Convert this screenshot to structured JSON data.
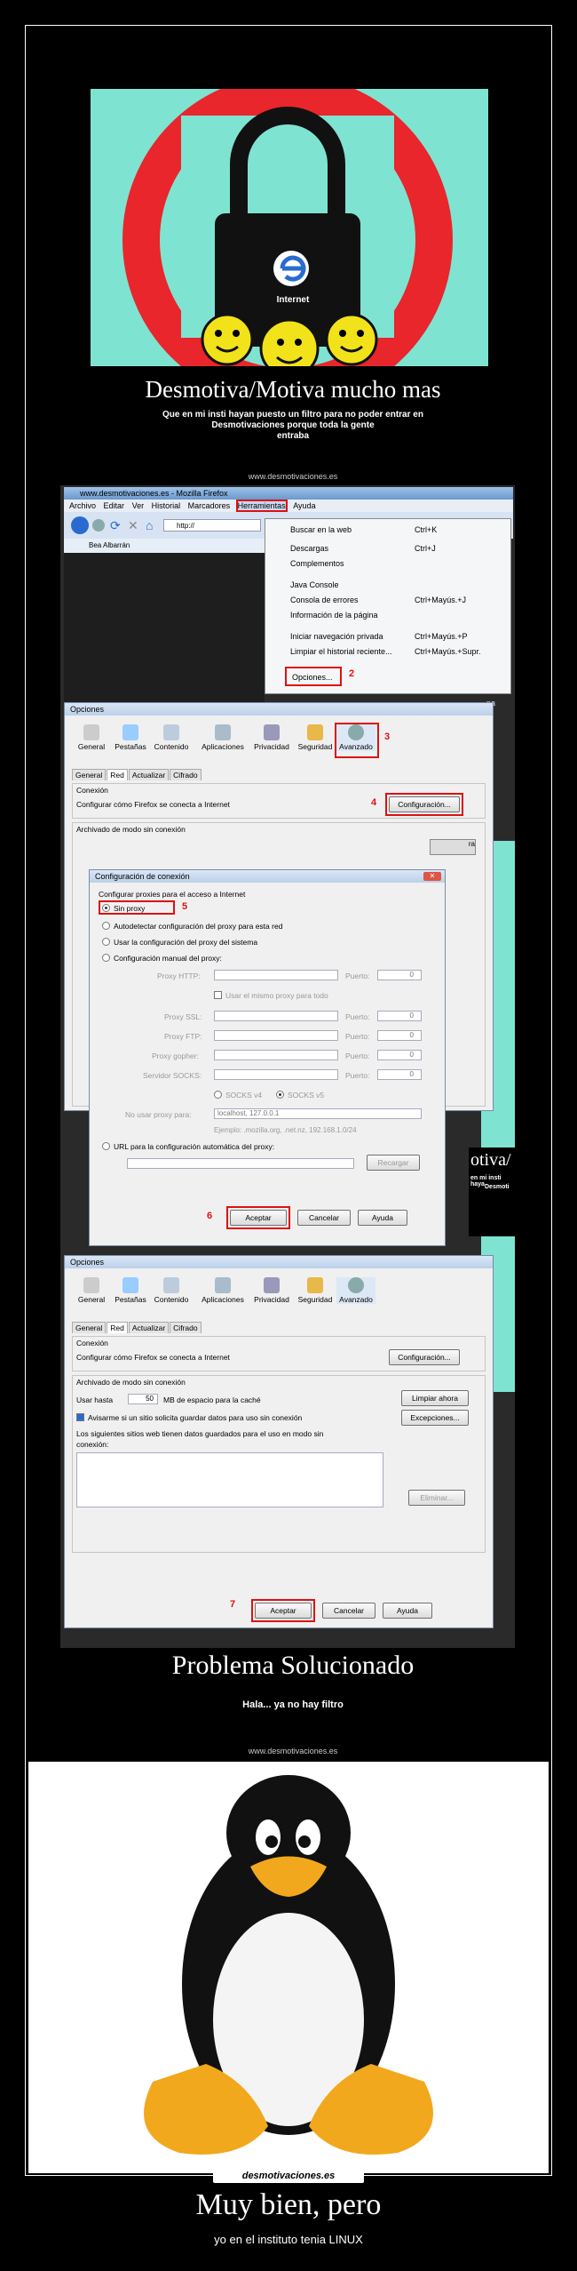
{
  "poster1": {
    "icon_label": "Internet",
    "title": "Desmotiva/Motiva mucho mas",
    "subtitle_line1": "Que en mi insti hayan puesto un filtro para no poder entrar en",
    "subtitle_line2": "Desmotivaciones porque toda la gente",
    "subtitle_line3": "entraba",
    "site": "www.desmotivaciones.es"
  },
  "firefox": {
    "title": "www.desmotivaciones.es - Mozilla Firefox",
    "menu": [
      "Archivo",
      "Editar",
      "Ver",
      "Historial",
      "Marcadores",
      "Herramientas",
      "Ayuda"
    ],
    "url": "http://",
    "tab": "Bea Albarrán",
    "dropdown": [
      {
        "label": "Buscar en la web",
        "key": "Ctrl+K"
      },
      {
        "label": "Descargas",
        "key": "Ctrl+J"
      },
      {
        "label": "Complementos",
        "key": ""
      },
      {
        "label": "Java Console",
        "key": ""
      },
      {
        "label": "Consola de errores",
        "key": "Ctrl+Mayús.+J"
      },
      {
        "label": "Información de la página",
        "key": ""
      },
      {
        "label": "Iniciar navegación privada",
        "key": "Ctrl+Mayús.+P"
      },
      {
        "label": "Limpiar el historial reciente...",
        "key": "Ctrl+Mayús.+Supr."
      },
      {
        "label": "Opciones...",
        "key": ""
      }
    ],
    "step2": "2"
  },
  "options": {
    "title": "Opciones",
    "toolbar": [
      "General",
      "Pestañas",
      "Contenido",
      "Aplicaciones",
      "Privacidad",
      "Seguridad",
      "Avanzado"
    ],
    "subtabs": [
      "General",
      "Red",
      "Actualizar",
      "Cifrado"
    ],
    "conexion_heading": "Conexión",
    "conexion_text": "Configurar cómo Firefox se conecta a Internet",
    "config_button": "Configuración...",
    "offline_heading": "Archivado de modo sin conexión",
    "step3": "3",
    "step4": "4"
  },
  "conn": {
    "title": "Configuración de conexión",
    "heading": "Configurar proxies para el acceso a Internet",
    "opt_none": "Sin proxy",
    "opt_auto": "Autodetectar configuración del proxy para esta red",
    "opt_system": "Usar la configuración del proxy del sistema",
    "opt_manual": "Configuración manual del proxy:",
    "http": "Proxy HTTP:",
    "same": "Usar el mismo proxy para todo",
    "ssl": "Proxy SSL:",
    "ftp": "Proxy FTP:",
    "gopher": "Proxy gopher:",
    "socks": "Servidor SOCKS:",
    "port": "Puerto:",
    "port_val": "0",
    "socks4": "SOCKS v4",
    "socks5": "SOCKS v5",
    "noproxy_label": "No usar proxy para:",
    "noproxy_value": "localhost, 127.0.0.1",
    "example": "Ejemplo: .mozilla.org, .net.nz, 192.168.1.0/24",
    "auto_url": "URL para la configuración automática del proxy:",
    "reload": "Recargar",
    "accept": "Aceptar",
    "cancel": "Cancelar",
    "help": "Ayuda",
    "step5": "5",
    "step6": "6"
  },
  "options2": {
    "title": "Opciones",
    "conexion_heading": "Conexión",
    "conexion_text": "Configurar cómo Firefox se conecta a Internet",
    "config_button": "Configuración...",
    "offline_heading": "Archivado de modo sin conexión",
    "use_up_to": "Usar hasta",
    "mb_value": "50",
    "mb_text": "MB de espacio para la caché",
    "clear_now": "Limpiar ahora",
    "notify": "Avisarme si un sitio solicita guardar datos para uso sin conexión",
    "exceptions": "Excepciones...",
    "stored_line1": "Los siguientes sitios web tienen datos guardados para el uso en modo sin",
    "stored_line2": "conexión:",
    "remove": "Eliminar...",
    "accept": "Aceptar",
    "cancel": "Cancelar",
    "help": "Ayuda",
    "step7": "7"
  },
  "poster2": {
    "title": "Problema Solucionado",
    "subtitle": "Hala... ya no hay filtro",
    "site": "www.desmotivaciones.es"
  },
  "footer": {
    "logo": "desmotivaciones.es",
    "title": "Muy bien, pero",
    "subtitle": "yo en el instituto tenia LINUX"
  },
  "colors": {
    "accent_red": "#dd1111",
    "poster_teal": "#7fe3d2",
    "at_red": "#e8262b"
  },
  "side_fragments": {
    "ra": "ra",
    "na": "na",
    "otiva": "otiva/",
    "insti": "en mi insti haya",
    "desmot": "Desmoti"
  }
}
